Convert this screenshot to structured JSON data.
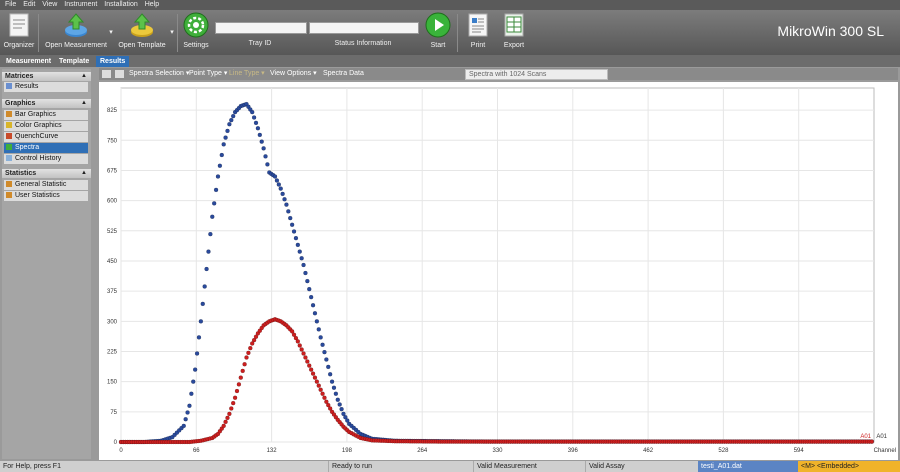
{
  "menu": [
    "File",
    "Edit",
    "View",
    "Instrument",
    "Installation",
    "Help"
  ],
  "ribbon": {
    "organizer": "Organizer",
    "open_measurement": "Open Measurement",
    "open_template": "Open Template",
    "settings": "Settings",
    "tray_id_label": "Tray ID",
    "status_info_label": "Status Information",
    "start": "Start",
    "print": "Print",
    "export": "Export",
    "app_title": "MikroWin 300 SL"
  },
  "tabs": [
    "Measurement",
    "Template",
    "Results"
  ],
  "sidebar": {
    "matrices": {
      "title": "Matrices",
      "items": [
        "Results"
      ]
    },
    "graphics": {
      "title": "Graphics",
      "items": [
        "Bar Graphics",
        "Color Graphics",
        "QuenchCurve",
        "Spectra",
        "Control History"
      ]
    },
    "statistics": {
      "title": "Statistics",
      "items": [
        "General Statistic",
        "User Statistics"
      ]
    }
  },
  "toolbar": {
    "spectra_selection": "Spectra Selection",
    "point_type": "Point Type",
    "line_type": "Line Type",
    "view_options": "View Options",
    "spectra_data": "Spectra Data",
    "caption": "Spectra with 1024 Scans"
  },
  "colors": {
    "blue_series": "#2a4a9c",
    "red_series": "#cc1f1f",
    "selected": "#2f6fb6"
  },
  "chart_data": {
    "type": "scatter",
    "xlabel": "Channel",
    "x_ticks": [
      0,
      66,
      132,
      198,
      264,
      330,
      396,
      462,
      528,
      594
    ],
    "y_ticks": [
      0,
      75,
      150,
      225,
      300,
      375,
      450,
      525,
      600,
      675,
      750,
      825
    ],
    "xlim": [
      0,
      660
    ],
    "ylim": [
      0,
      880
    ],
    "grid": true,
    "series": [
      {
        "name": "A01",
        "color": "#2a4a9c",
        "x": [
          0,
          20,
          35,
          45,
          55,
          60,
          65,
          70,
          75,
          80,
          85,
          90,
          95,
          100,
          105,
          110,
          115,
          120,
          125,
          130,
          135,
          140,
          145,
          150,
          155,
          160,
          165,
          170,
          175,
          180,
          185,
          190,
          195,
          200,
          210,
          220,
          240,
          280,
          320,
          400,
          500,
          600,
          660
        ],
        "y": [
          0,
          0,
          3,
          12,
          40,
          90,
          180,
          300,
          430,
          560,
          660,
          740,
          790,
          820,
          835,
          840,
          820,
          780,
          730,
          670,
          660,
          630,
          590,
          540,
          490,
          440,
          380,
          320,
          260,
          205,
          150,
          105,
          70,
          45,
          20,
          8,
          3,
          2,
          1,
          1,
          1,
          1,
          1
        ]
      },
      {
        "name": "A01",
        "color": "#cc1f1f",
        "x": [
          0,
          40,
          60,
          70,
          80,
          85,
          90,
          95,
          100,
          105,
          110,
          115,
          120,
          125,
          130,
          135,
          140,
          145,
          150,
          155,
          160,
          165,
          170,
          175,
          180,
          185,
          190,
          195,
          200,
          210,
          220,
          240,
          280,
          320,
          400,
          500,
          600,
          660
        ],
        "y": [
          0,
          0,
          0,
          3,
          10,
          20,
          40,
          70,
          110,
          160,
          210,
          245,
          270,
          290,
          300,
          305,
          300,
          290,
          275,
          250,
          220,
          190,
          160,
          130,
          100,
          75,
          55,
          38,
          25,
          10,
          4,
          2,
          1,
          1,
          1,
          1,
          1,
          1
        ]
      }
    ]
  },
  "status": {
    "help": "For Help, press F1",
    "ready": "Ready to run",
    "valid_measurement": "Valid Measurement",
    "valid_assay": "Valid Assay",
    "file": "testi_A01.dat",
    "embedded": "<M> <Embedded>"
  }
}
